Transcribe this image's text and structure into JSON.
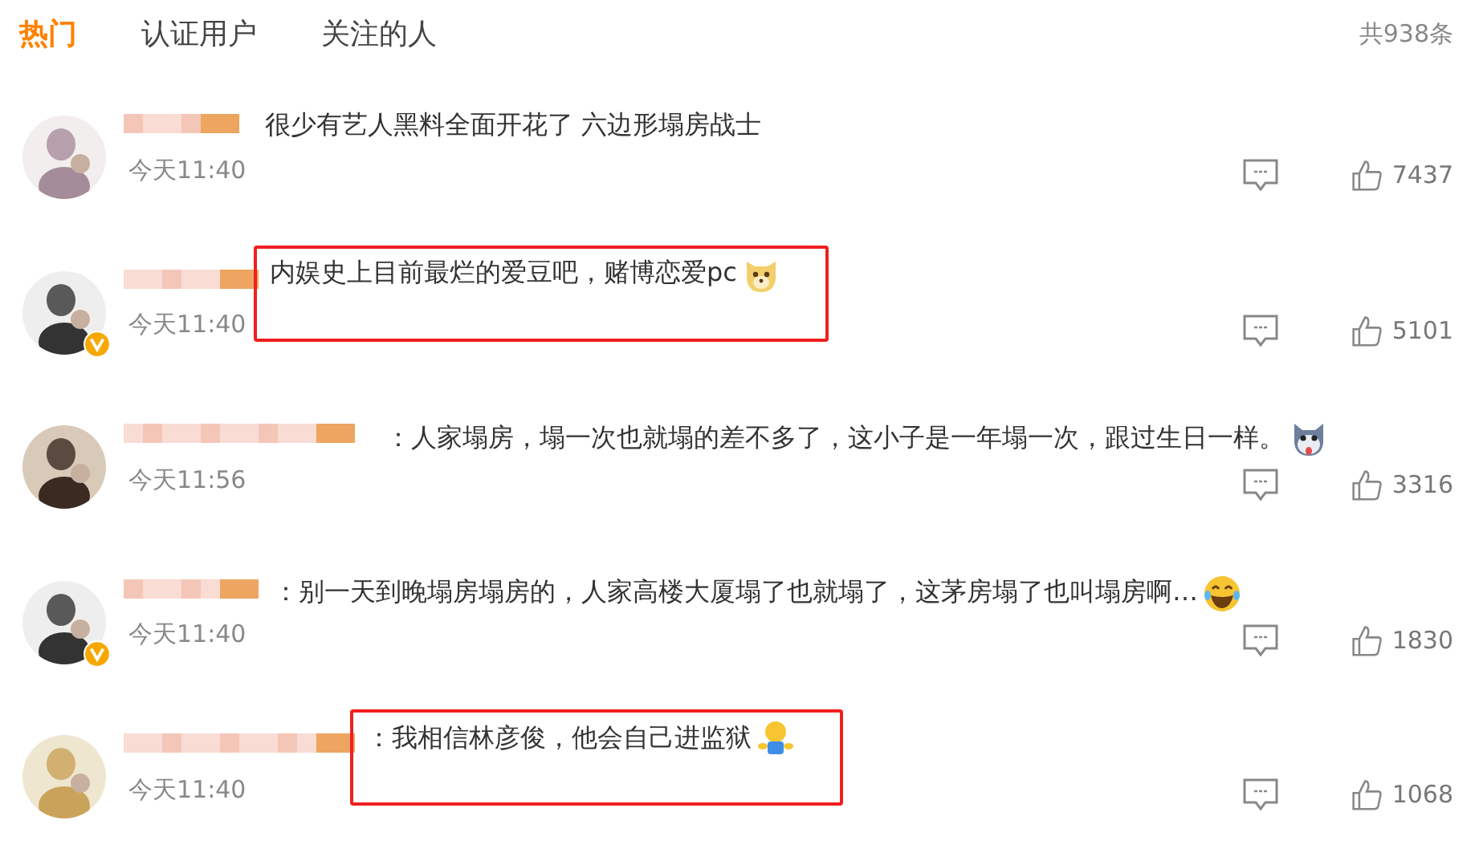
{
  "tabs": [
    {
      "label": "热门",
      "selected": true
    },
    {
      "label": "认证用户",
      "selected": false
    },
    {
      "label": "关注的人",
      "selected": false
    }
  ],
  "total": "共938条",
  "comments": [
    {
      "verified": false,
      "highlighted": false,
      "text": "很少有艺人黑料全面开花了 六边形塌房战士",
      "time": "今天11:40",
      "likes": "7437"
    },
    {
      "verified": true,
      "highlighted": true,
      "text": "内娱史上目前最烂的爱豆吧，赌博恋爱pc",
      "emoji": {
        "kind": "doge"
      },
      "time": "今天11:40",
      "likes": "5101"
    },
    {
      "verified": false,
      "highlighted": false,
      "text": "：人家塌房，塌一次也就塌的差不多了，这小子是一年塌一次，跟过生日一样。",
      "emoji": {
        "kind": "husky"
      },
      "time": "今天11:56",
      "likes": "3316"
    },
    {
      "verified": true,
      "highlighted": false,
      "text": "：别一天到晚塌房塌房的，人家高楼大厦塌了也就塌了，这茅房塌了也叫塌房啊…",
      "emoji": {
        "kind": "laugh"
      },
      "time": "今天11:40",
      "likes": "1830"
    },
    {
      "verified": false,
      "highlighted": true,
      "text": "：我相信林彦俊，他会自己进监狱",
      "emoji": {
        "kind": "shrug"
      },
      "time": "今天11:40",
      "likes": "1068"
    }
  ]
}
